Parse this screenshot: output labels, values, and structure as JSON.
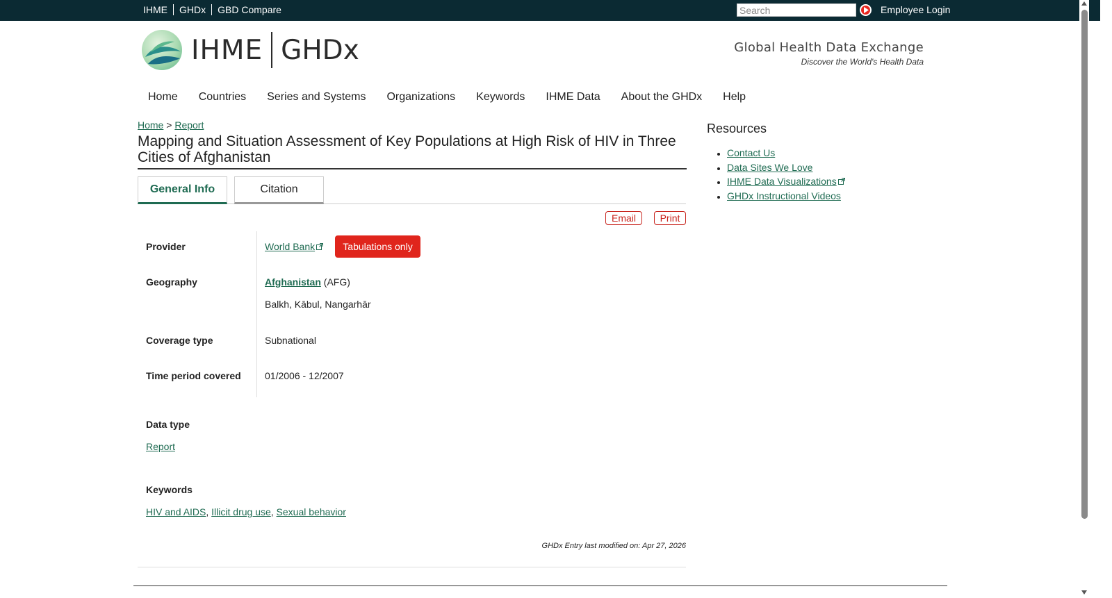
{
  "topnav": {
    "items": [
      "IHME",
      "GHDx",
      "GBD Compare"
    ]
  },
  "search": {
    "placeholder": "Search"
  },
  "employee_login": "Employee Login",
  "logo": {
    "left": "IHME",
    "right": "GHDx"
  },
  "site_title": {
    "main": "Global Health Data Exchange",
    "tagline": "Discover the World's Health Data"
  },
  "mainnav": {
    "items": [
      "Home",
      "Countries",
      "Series and Systems",
      "Organizations",
      "Keywords",
      "IHME Data",
      "About the GHDx",
      "Help"
    ]
  },
  "breadcrumb": {
    "home": "Home",
    "separator": ">",
    "current": "Report"
  },
  "page_title": "Mapping and Situation Assessment of Key Populations at High Risk of HIV in Three Cities of Afghanistan",
  "tabs": {
    "general": "General Info",
    "citation": "Citation"
  },
  "actions": {
    "email": "Email",
    "print": "Print"
  },
  "details": {
    "provider_label": "Provider",
    "provider_value": "World Bank",
    "tabulations_badge": "Tabulations only",
    "geography_label": "Geography",
    "geography_country": "Afghanistan",
    "geography_code": "(AFG)",
    "geography_subregions": "Balkh, Kābul, Nangarhār",
    "coverage_label": "Coverage type",
    "coverage_value": "Subnational",
    "time_label": "Time period covered",
    "time_value": "01/2006 - 12/2007"
  },
  "data_type": {
    "label": "Data type",
    "value": "Report"
  },
  "keywords": {
    "label": "Keywords",
    "items": [
      "HIV and AIDS",
      "Illicit drug use",
      "Sexual behavior"
    ],
    "separator": ","
  },
  "last_modified": "GHDx Entry last modified on: Apr 27, 2026",
  "resources": {
    "title": "Resources",
    "items": [
      "Contact Us",
      "Data Sites We Love",
      "IHME Data Visualizations",
      "GHDx Instructional Videos"
    ]
  },
  "colors": {
    "topbar": "#0b2a33",
    "link": "#1f6b52",
    "accent_red": "#e0251c"
  }
}
